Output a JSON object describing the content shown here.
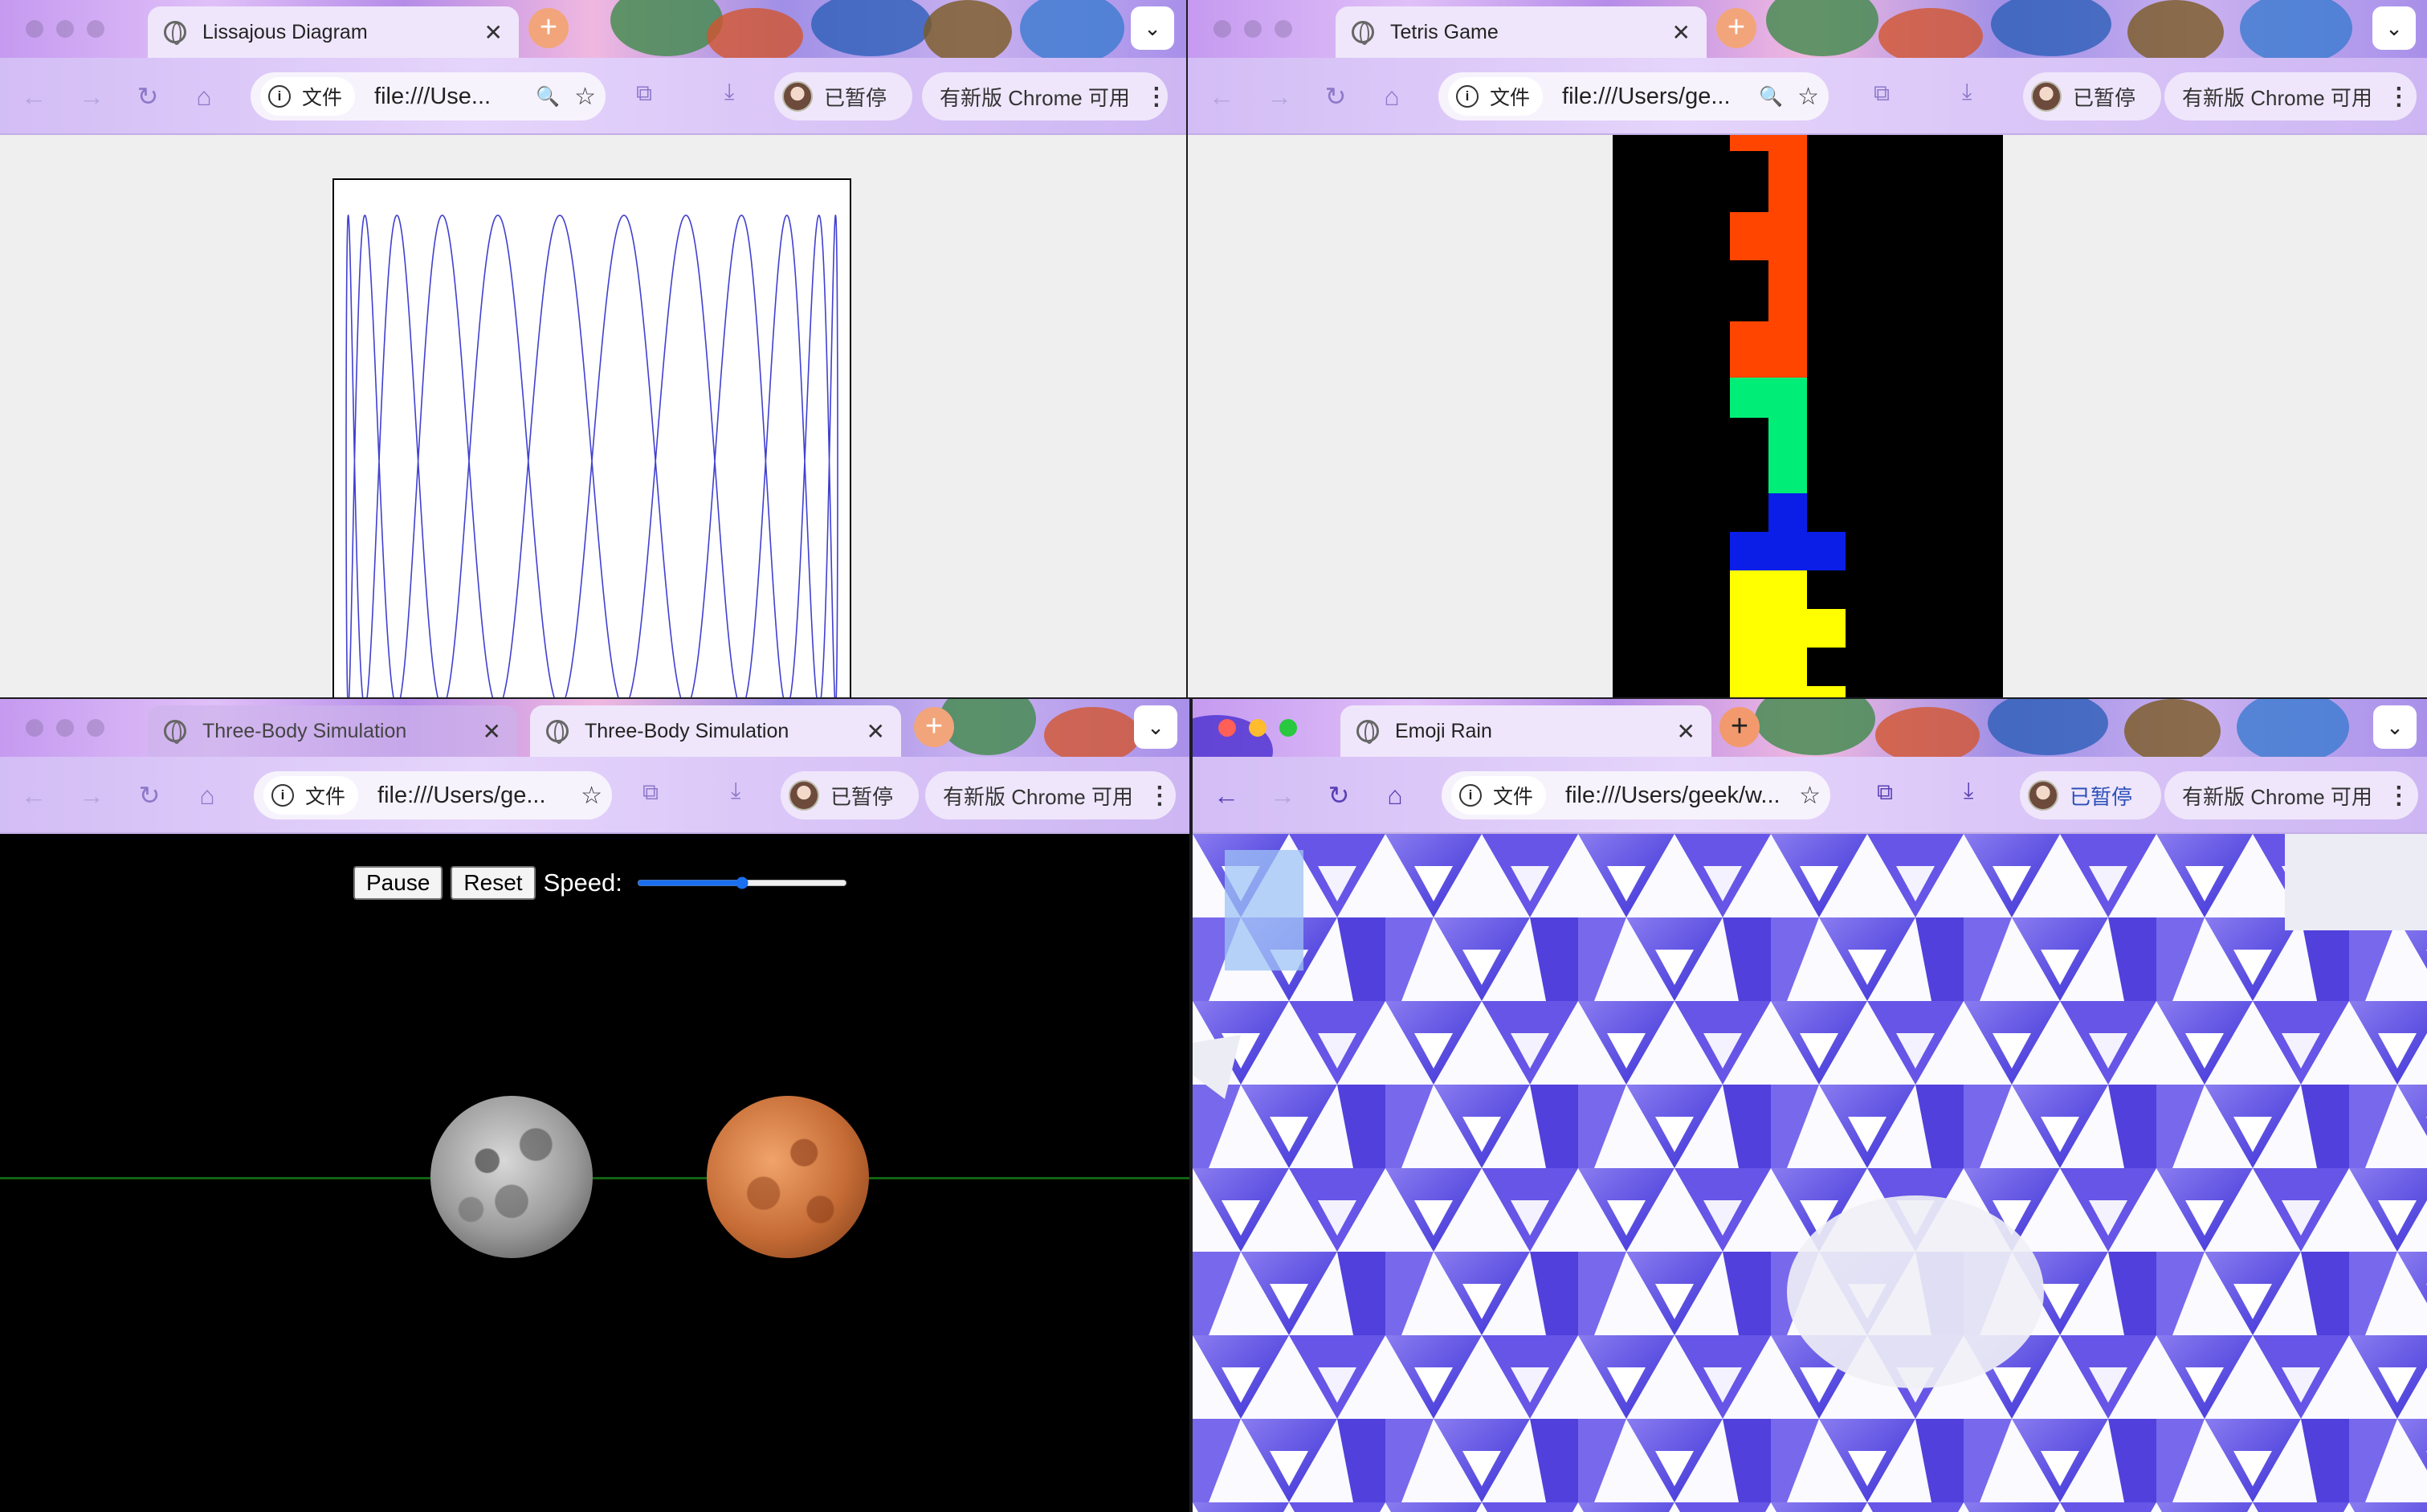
{
  "colors": {
    "tetris_red": "#ff4500",
    "tetris_green": "#00ee77",
    "tetris_blue": "#0a1ee8",
    "tetris_yellow": "#ffff00",
    "lissajous_curve": "#4040d0",
    "orbit_line": "#126312",
    "emoji_pattern": "#6250e0"
  },
  "windows": {
    "lissajous": {
      "tab_title": "Lissajous Diagram",
      "chip_label": "文件",
      "url": "file:///Use...",
      "profile_label": "已暂停",
      "update_label": "有新版 Chrome 可用",
      "curve": {
        "a": 1,
        "b": 12,
        "phase": 1.5707963
      }
    },
    "tetris": {
      "tab_title": "Tetris Game",
      "chip_label": "文件",
      "url": "file:///Users/ge...",
      "profile_label": "已暂停",
      "update_label": "有新版 Chrome 可用"
    },
    "three_body": {
      "tabs": [
        {
          "title": "Three-Body Simulation"
        },
        {
          "title": "Three-Body Simulation"
        }
      ],
      "chip_label": "文件",
      "url": "file:///Users/ge...",
      "profile_label": "已暂停",
      "update_label": "有新版 Chrome 可用",
      "controls": {
        "pause_label": "Pause",
        "reset_label": "Reset",
        "speed_label": "Speed:",
        "speed_value": 50
      }
    },
    "emoji_rain": {
      "tab_title": "Emoji Rain",
      "chip_label": "文件",
      "url": "file:///Users/geek/w...",
      "profile_label": "已暂停",
      "update_label": "有新版 Chrome 可用"
    }
  },
  "icons": {
    "back": "←",
    "forward": "→",
    "reload": "↻",
    "home": "⌂",
    "close": "✕",
    "new_tab": "+",
    "tab_menu": "⌄",
    "zoom": "🔍",
    "star": "☆",
    "extensions": "⧉",
    "download": "⤓",
    "menu": "⋮"
  }
}
